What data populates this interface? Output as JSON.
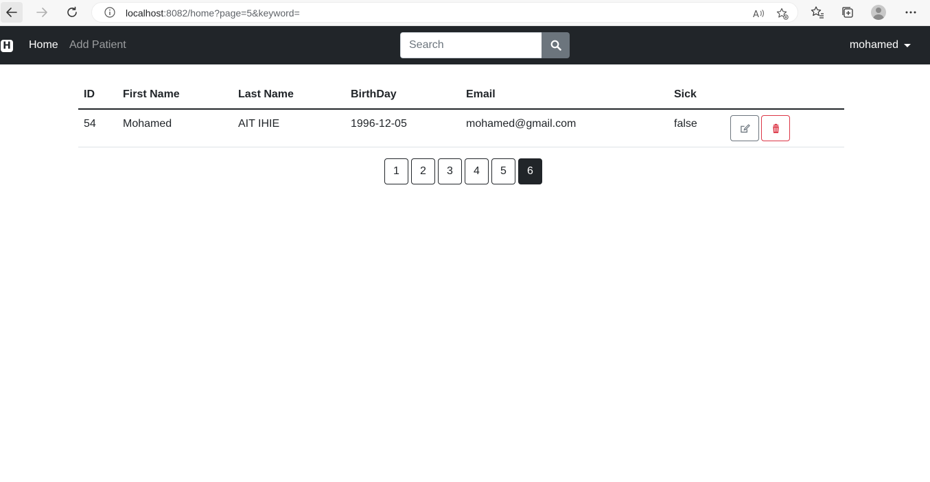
{
  "browser": {
    "url_host": "localhost",
    "url_rest": ":8082/home?page=5&keyword="
  },
  "navbar": {
    "brand_letter": "H",
    "links": [
      "Home",
      "Add Patient"
    ],
    "search_placeholder": "Search",
    "user": "mohamed"
  },
  "table": {
    "headers": [
      "ID",
      "First Name",
      "Last Name",
      "BirthDay",
      "Email",
      "Sick"
    ],
    "rows": [
      [
        "54",
        "Mohamed",
        "AIT IHIE",
        "1996-12-05",
        "mohamed@gmail.com",
        "false"
      ]
    ]
  },
  "pagination": {
    "pages": [
      "1",
      "2",
      "3",
      "4",
      "5",
      "6"
    ],
    "active_index": 5
  },
  "colors": {
    "navbar_bg": "#212529",
    "danger": "#dc3545",
    "secondary": "#6c757d"
  }
}
